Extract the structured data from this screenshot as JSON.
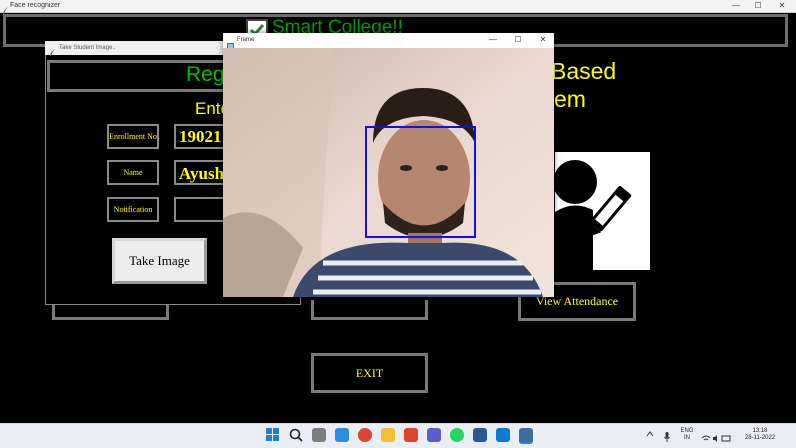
{
  "main_window": {
    "title": "Face recognizer",
    "header_title": "Smart College!!",
    "heading_line1_right": "Based",
    "heading_line2_right": "em",
    "buttons": {
      "view_attendance": "View Attendance",
      "exit": "EXIT"
    }
  },
  "take_student_image": {
    "title": "Take Student Image..",
    "heading_partial": "Reg",
    "subheading_partial": "Ente",
    "fields": [
      {
        "label": "Enrollment No",
        "value": "19021"
      },
      {
        "label": "Name",
        "value": "Ayush"
      },
      {
        "label": "Notification",
        "value": ""
      }
    ],
    "take_image_label": "Take Image"
  },
  "frame_window": {
    "title": "Frame"
  },
  "window_controls": {
    "minimize": "—",
    "maximize": "☐",
    "close": "✕"
  },
  "taskbar": {
    "tray": {
      "lang_top": "ENG",
      "lang_bottom": "IN",
      "time": "13:18",
      "date": "28-11-2022"
    }
  },
  "colors": {
    "accent_yellow": "#ffff00",
    "accent_green": "#00c000",
    "face_box": "#1010e0"
  }
}
